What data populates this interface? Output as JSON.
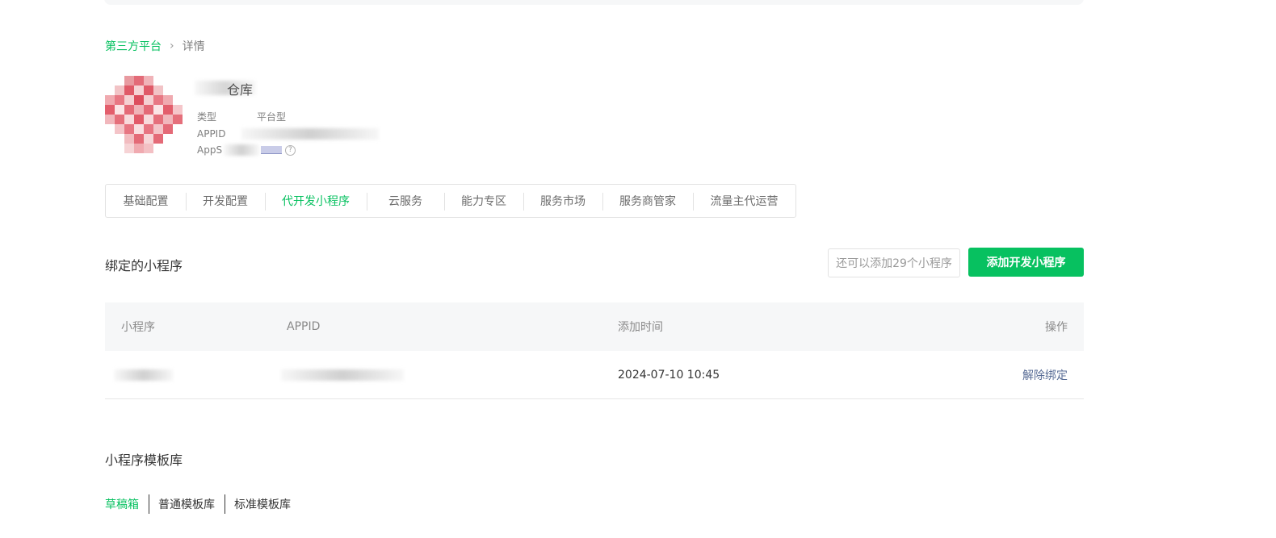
{
  "breadcrumb": {
    "parent": "第三方平台",
    "separator": "›",
    "current": "详情"
  },
  "app": {
    "name": "仓库",
    "type_label": "类型",
    "type_value": "平台型",
    "appid_label": "APPID",
    "appsecret_label": "AppS"
  },
  "tabs": [
    {
      "label": "基础配置"
    },
    {
      "label": "开发配置"
    },
    {
      "label": "代开发小程序"
    },
    {
      "label": "云服务"
    },
    {
      "label": "能力专区"
    },
    {
      "label": "服务市场"
    },
    {
      "label": "服务商管家"
    },
    {
      "label": "流量主代运营"
    }
  ],
  "bound": {
    "title": "绑定的小程序",
    "remaining": "还可以添加29个小程序",
    "add_button": "添加开发小程序",
    "columns": {
      "mini_program": "小程序",
      "appid": "APPID",
      "added_time": "添加时间",
      "action": "操作"
    },
    "rows": [
      {
        "name": "宾馆产品",
        "appid": "wx6b4...",
        "added_time": "2024-07-10 10:45",
        "action": "解除绑定"
      }
    ]
  },
  "templates": {
    "title": "小程序模板库",
    "subtabs": [
      {
        "label": "草稿箱"
      },
      {
        "label": "普通模板库"
      },
      {
        "label": "标准模板库"
      }
    ]
  },
  "colors": {
    "accent": "#07c160",
    "link": "#576b95"
  }
}
